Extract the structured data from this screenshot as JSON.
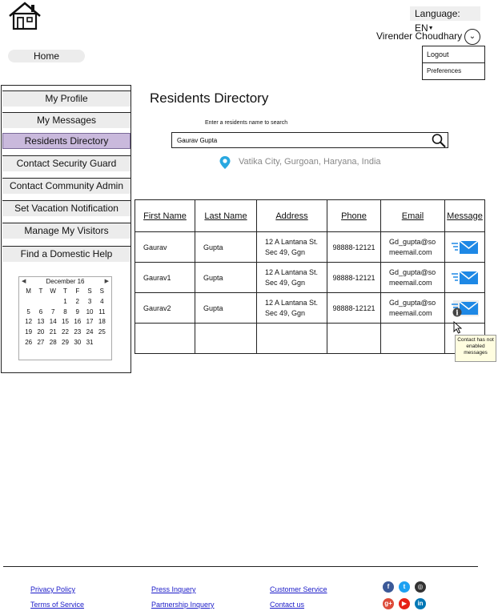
{
  "header": {
    "language_label": "Language: EN",
    "user_name": "Virender Choudhary",
    "home_label": "Home"
  },
  "user_menu": [
    "Logout",
    "Preferences"
  ],
  "sidebar": {
    "items": [
      {
        "label": "My Profile",
        "active": false
      },
      {
        "label": "My Messages",
        "active": false
      },
      {
        "label": "Residents Directory",
        "active": true
      },
      {
        "label": "Contact Security Guard",
        "active": false
      },
      {
        "label": "Contact Community Admin",
        "active": false
      },
      {
        "label": "Set Vacation Notification",
        "active": false
      },
      {
        "label": "Manage My Visitors",
        "active": false
      },
      {
        "label": "Find a Domestic Help",
        "active": false
      }
    ]
  },
  "calendar": {
    "month_label": "December 16",
    "weekdays": [
      "M",
      "T",
      "W",
      "T",
      "F",
      "S",
      "S"
    ],
    "days": [
      "",
      "",
      "",
      "1",
      "2",
      "3",
      "4",
      "5",
      "6",
      "7",
      "8",
      "9",
      "10",
      "11",
      "12",
      "13",
      "14",
      "15",
      "16",
      "17",
      "18",
      "19",
      "20",
      "21",
      "22",
      "23",
      "24",
      "25",
      "26",
      "27",
      "28",
      "29",
      "30",
      "31",
      ""
    ]
  },
  "main": {
    "title": "Residents Directory",
    "search_label": "Enter a residents name to search",
    "search_value": "Gaurav Gupta",
    "location": "Vatika City, Gurgoan, Haryana, India"
  },
  "table": {
    "headers": [
      "First Name",
      "Last Name",
      "Address",
      "Phone",
      "Email",
      "Message"
    ],
    "rows": [
      {
        "first": "Gaurav",
        "last": "Gupta",
        "addr1": "12 A Lantana St.",
        "addr2": "Sec 49, Ggn",
        "phone": "98888-12121",
        "email1": "Gd_gupta@so",
        "email2": "meemail.com",
        "msg_enabled": true
      },
      {
        "first": "Gaurav1",
        "last": "Gupta",
        "addr1": "12 A Lantana St.",
        "addr2": "Sec 49, Ggn",
        "phone": "98888-12121",
        "email1": "Gd_gupta@so",
        "email2": "meemail.com",
        "msg_enabled": true
      },
      {
        "first": "Gaurav2",
        "last": "Gupta",
        "addr1": "12 A Lantana St.",
        "addr2": "Sec 49, Ggn",
        "phone": "98888-12121",
        "email1": "Gd_gupta@so",
        "email2": "meemail.com",
        "msg_enabled": false
      }
    ],
    "tooltip": "Contact has not enabled messages"
  },
  "footer": {
    "links": [
      "Privacy Policy",
      "Terms of Service",
      "Press Inquery",
      "Partnership Inquery",
      "Customer Service",
      "Contact us"
    ],
    "social": [
      {
        "icon": "facebook-icon",
        "glyph": "f",
        "color": "#3b5998"
      },
      {
        "icon": "twitter-icon",
        "glyph": "t",
        "color": "#1da1f2"
      },
      {
        "icon": "instagram-icon",
        "glyph": "◎",
        "color": "#333333"
      },
      {
        "icon": "google-plus-icon",
        "glyph": "g+",
        "color": "#dd4b39"
      },
      {
        "icon": "youtube-icon",
        "glyph": "▶",
        "color": "#e62117"
      },
      {
        "icon": "linkedin-icon",
        "glyph": "in",
        "color": "#0077b5"
      }
    ]
  },
  "colors": {
    "active_nav": "#c9b9dc",
    "mail_icon": "#1e88e5",
    "link": "#1a1ac8",
    "location_pin": "#29a8e0"
  }
}
